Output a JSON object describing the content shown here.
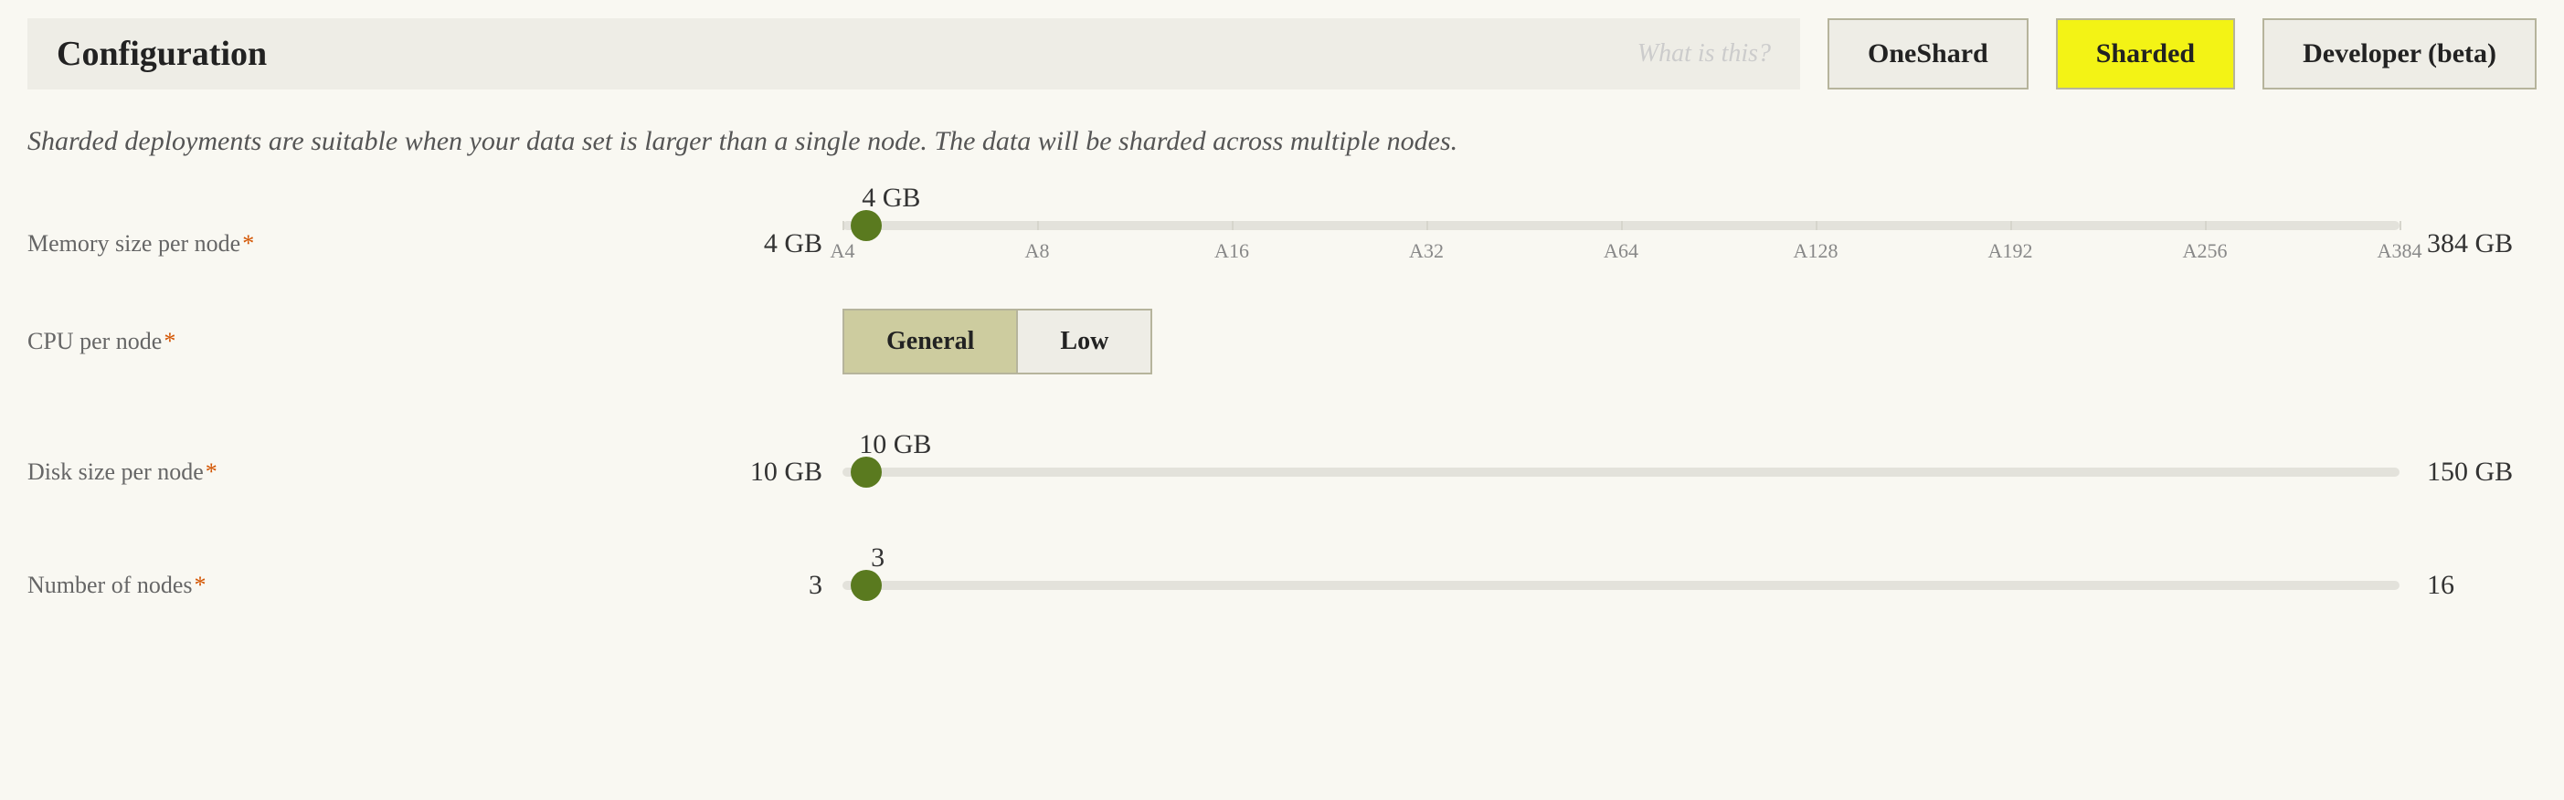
{
  "header": {
    "title": "Configuration",
    "hint": "What is this?"
  },
  "tabs": {
    "oneshard": "OneShard",
    "sharded": "Sharded",
    "developer": "Developer (beta)"
  },
  "description": "Sharded deployments are suitable when your data set is larger than a single node. The data will be sharded across multiple nodes.",
  "memory": {
    "label": "Memory size per node",
    "min": "4 GB",
    "max": "384 GB",
    "value": "4 GB",
    "ticks": [
      "A4",
      "A8",
      "A16",
      "A32",
      "A64",
      "A128",
      "A192",
      "A256",
      "A384"
    ]
  },
  "cpu": {
    "label": "CPU per node",
    "general": "General",
    "low": "Low"
  },
  "disk": {
    "label": "Disk size per node",
    "min": "10 GB",
    "max": "150 GB",
    "value": "10 GB"
  },
  "nodes": {
    "label": "Number of nodes",
    "min": "3",
    "max": "16",
    "value": "3"
  }
}
